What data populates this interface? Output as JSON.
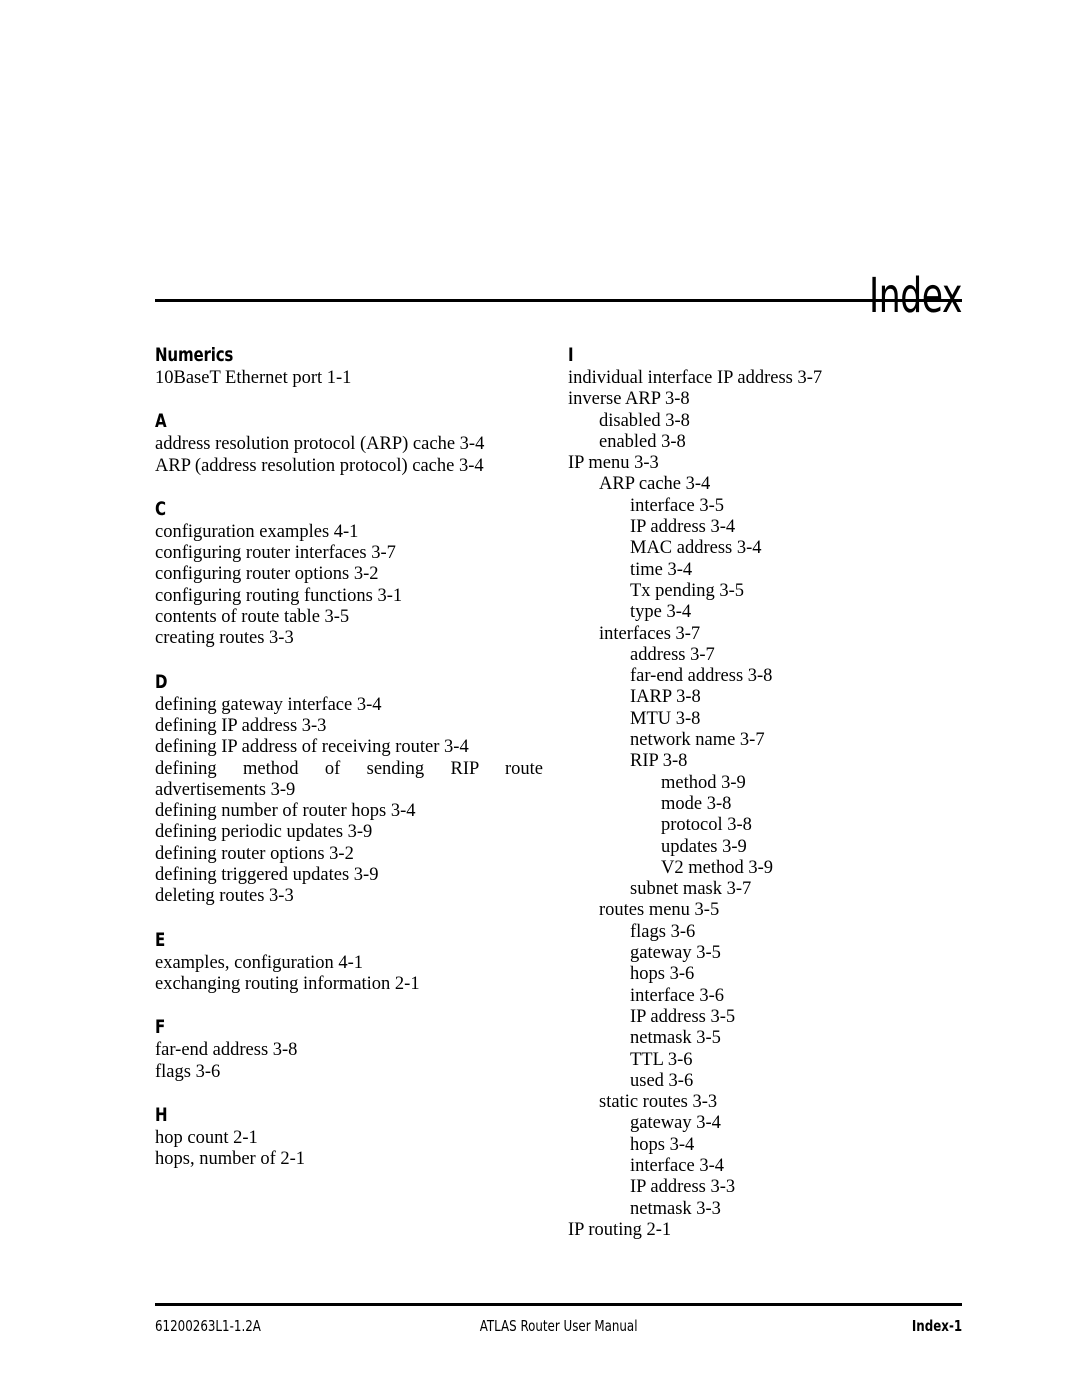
{
  "page": {
    "title": "Index"
  },
  "footer": {
    "document_number": "61200263L1-1.2A",
    "manual_title": "ATLAS Router User Manual",
    "page_label": "Index-1"
  },
  "columns": {
    "left": [
      {
        "letter": "Numerics",
        "entries": [
          {
            "text": "10BaseT Ethernet port 1-1",
            "level": 0
          }
        ]
      },
      {
        "letter": "A",
        "entries": [
          {
            "text": "address resolution protocol (ARP) cache 3-4",
            "level": 0
          },
          {
            "text": "ARP (address resolution protocol) cache 3-4",
            "level": 0
          }
        ]
      },
      {
        "letter": "C",
        "entries": [
          {
            "text": "configuration examples 4-1",
            "level": 0
          },
          {
            "text": "configuring router interfaces 3-7",
            "level": 0
          },
          {
            "text": "configuring router options 3-2",
            "level": 0
          },
          {
            "text": "configuring routing functions 3-1",
            "level": 0
          },
          {
            "text": "contents of route table 3-5",
            "level": 0
          },
          {
            "text": "creating routes 3-3",
            "level": 0
          }
        ]
      },
      {
        "letter": "D",
        "entries": [
          {
            "text": "defining gateway interface 3-4",
            "level": 0
          },
          {
            "text": "defining IP address 3-3",
            "level": 0
          },
          {
            "text": "defining IP address of receiving router 3-4",
            "level": 0
          },
          {
            "text": "defining method of sending RIP route advertisements 3-9",
            "level": 0,
            "wrap": true
          },
          {
            "text": "defining number of router hops 3-4",
            "level": 0
          },
          {
            "text": "defining periodic updates 3-9",
            "level": 0
          },
          {
            "text": "defining router options 3-2",
            "level": 0
          },
          {
            "text": "defining triggered updates 3-9",
            "level": 0
          },
          {
            "text": "deleting routes 3-3",
            "level": 0
          }
        ]
      },
      {
        "letter": "E",
        "entries": [
          {
            "text": "examples, configuration 4-1",
            "level": 0
          },
          {
            "text": "exchanging routing information 2-1",
            "level": 0
          }
        ]
      },
      {
        "letter": "F",
        "entries": [
          {
            "text": "far-end address 3-8",
            "level": 0
          },
          {
            "text": "flags 3-6",
            "level": 0
          }
        ]
      },
      {
        "letter": "H",
        "entries": [
          {
            "text": "hop count 2-1",
            "level": 0
          },
          {
            "text": "hops, number of 2-1",
            "level": 0
          }
        ]
      }
    ],
    "right": [
      {
        "letter": "I",
        "entries": [
          {
            "text": "individual interface IP address 3-7",
            "level": 0
          },
          {
            "text": "inverse ARP 3-8",
            "level": 0
          },
          {
            "text": "disabled 3-8",
            "level": 1
          },
          {
            "text": "enabled 3-8",
            "level": 1
          },
          {
            "text": "IP menu 3-3",
            "level": 0
          },
          {
            "text": "ARP cache 3-4",
            "level": 1
          },
          {
            "text": "interface 3-5",
            "level": 2
          },
          {
            "text": "IP address 3-4",
            "level": 2
          },
          {
            "text": "MAC address 3-4",
            "level": 2
          },
          {
            "text": "time 3-4",
            "level": 2
          },
          {
            "text": "Tx pending 3-5",
            "level": 2
          },
          {
            "text": "type 3-4",
            "level": 2
          },
          {
            "text": "interfaces 3-7",
            "level": 1
          },
          {
            "text": "address 3-7",
            "level": 2
          },
          {
            "text": "far-end address 3-8",
            "level": 2
          },
          {
            "text": "IARP 3-8",
            "level": 2
          },
          {
            "text": "MTU 3-8",
            "level": 2
          },
          {
            "text": "network name 3-7",
            "level": 2
          },
          {
            "text": "RIP 3-8",
            "level": 2
          },
          {
            "text": "method 3-9",
            "level": 3
          },
          {
            "text": "mode 3-8",
            "level": 3
          },
          {
            "text": "protocol 3-8",
            "level": 3
          },
          {
            "text": "updates 3-9",
            "level": 3
          },
          {
            "text": "V2 method 3-9",
            "level": 3
          },
          {
            "text": "subnet mask 3-7",
            "level": 2
          },
          {
            "text": "routes menu 3-5",
            "level": 1
          },
          {
            "text": "flags 3-6",
            "level": 2
          },
          {
            "text": "gateway 3-5",
            "level": 2
          },
          {
            "text": "hops 3-6",
            "level": 2
          },
          {
            "text": "interface 3-6",
            "level": 2
          },
          {
            "text": "IP address 3-5",
            "level": 2
          },
          {
            "text": "netmask 3-5",
            "level": 2
          },
          {
            "text": "TTL 3-6",
            "level": 2
          },
          {
            "text": "used 3-6",
            "level": 2
          },
          {
            "text": "static routes 3-3",
            "level": 1
          },
          {
            "text": "gateway 3-4",
            "level": 2
          },
          {
            "text": "hops 3-4",
            "level": 2
          },
          {
            "text": "interface 3-4",
            "level": 2
          },
          {
            "text": "IP address 3-3",
            "level": 2
          },
          {
            "text": "netmask 3-3",
            "level": 2
          },
          {
            "text": "IP routing 2-1",
            "level": 0
          }
        ]
      }
    ]
  }
}
